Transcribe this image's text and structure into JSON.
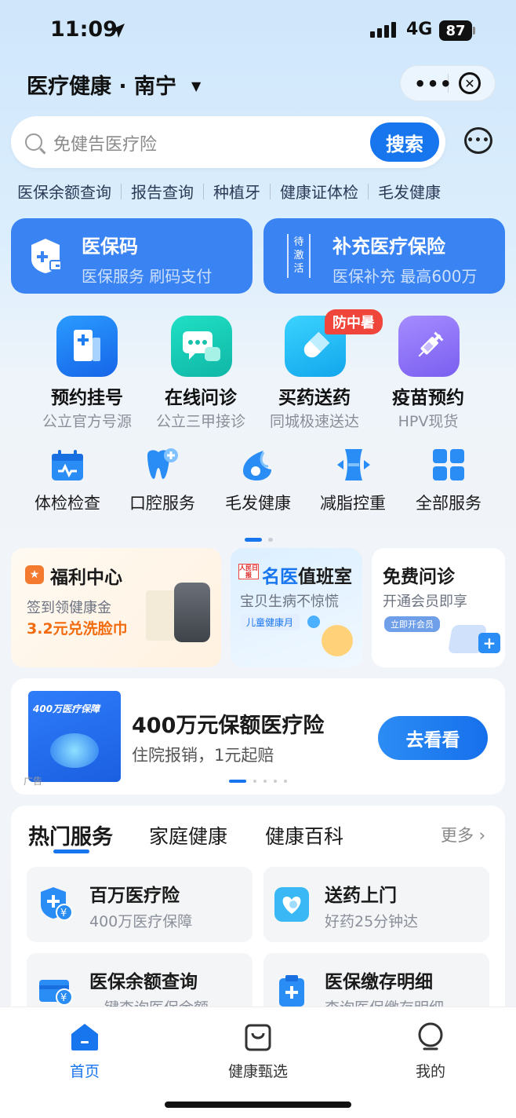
{
  "status": {
    "time": "11:09",
    "network": "4G",
    "battery": "87"
  },
  "header": {
    "title": "医疗健康 · 南宁",
    "menu_dots": "•••"
  },
  "search": {
    "placeholder": "免健告医疗险",
    "button": "搜索"
  },
  "quick_links": [
    "医保余额查询",
    "报告查询",
    "种植牙",
    "健康证体检",
    "毛发健康"
  ],
  "top_cards": [
    {
      "title": "医保码",
      "subtitle": "医保服务 刷码支付"
    },
    {
      "title": "补充医疗保险",
      "subtitle": "医保补充 最高600万",
      "tag": "待激活"
    }
  ],
  "main_services": [
    {
      "title": "预约挂号",
      "subtitle": "公立官方号源"
    },
    {
      "title": "在线问诊",
      "subtitle": "公立三甲接诊"
    },
    {
      "title": "买药送药",
      "subtitle": "同城极速送达",
      "badge": "防中暑"
    },
    {
      "title": "疫苗预约",
      "subtitle": "HPV现货"
    }
  ],
  "secondary_services": [
    "体检检查",
    "口腔服务",
    "毛发健康",
    "减脂控重",
    "全部服务"
  ],
  "promos": {
    "welfare": {
      "title": "福利中心",
      "line1": "签到领健康金",
      "line2": "3.2元兑洗脸巾"
    },
    "doctor": {
      "title_prefix": "名医",
      "title_rest": "值班室",
      "subtitle": "宝贝生病不惊慌",
      "tag": "儿童健康月",
      "logo_text": "人民日报"
    },
    "consult": {
      "title": "免费问诊",
      "subtitle": "开通会员即享",
      "tag": "立即开会员"
    }
  },
  "ad": {
    "image_title": "400万医疗保障",
    "title": "400万元保额医疗险",
    "subtitle": "住院报销，1元起赔",
    "button": "去看看",
    "label": "广告"
  },
  "hot_panel": {
    "tabs": [
      "热门服务",
      "家庭健康",
      "健康百科"
    ],
    "more": "更多",
    "items": [
      {
        "title": "百万医疗险",
        "subtitle": "400万医疗保障"
      },
      {
        "title": "送药上门",
        "subtitle": "好药25分钟达"
      },
      {
        "title": "医保余额查询",
        "subtitle": "一键查询医保余额"
      },
      {
        "title": "医保缴存明细",
        "subtitle": "查询医保缴存明细"
      }
    ]
  },
  "bottom_nav": [
    {
      "label": "首页",
      "active": true
    },
    {
      "label": "健康甄选",
      "active": false
    },
    {
      "label": "我的",
      "active": false
    }
  ],
  "colors": {
    "primary": "#1775EE",
    "card_blue": "#3A83F2",
    "badge_red": "#F0453A",
    "highlight_orange": "#F36B0F"
  }
}
